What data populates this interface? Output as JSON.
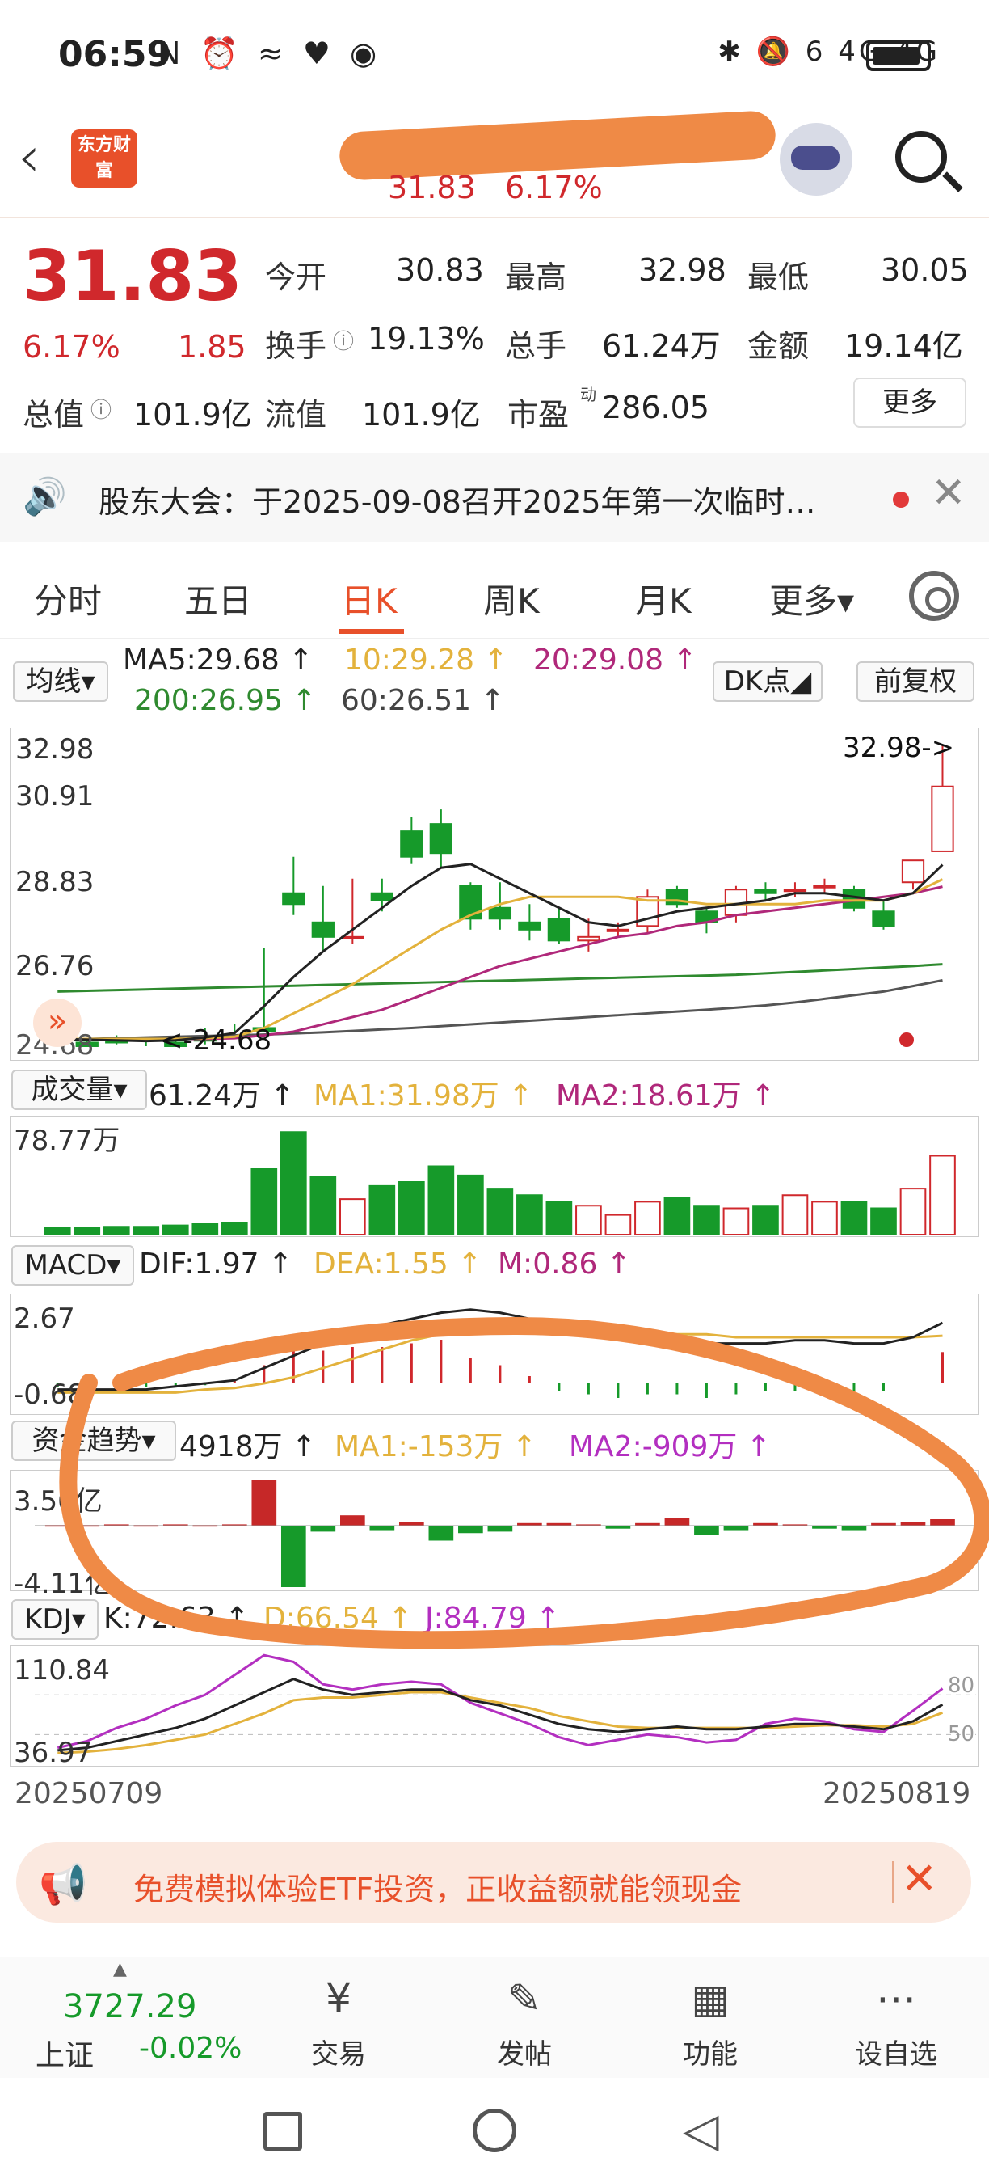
{
  "status_bar": {
    "time": "06:59",
    "left_icons": "N ⏰ ≈ ♥ ◉",
    "right_icons": "✱ 🔕 6 4G 4G"
  },
  "header": {
    "logo": "东方财富",
    "price": "31.83",
    "pct": "6.17%"
  },
  "quote": {
    "price": "31.83",
    "pct": "6.17%",
    "change": "1.85",
    "open_label": "今开",
    "open": "30.83",
    "high_label": "最高",
    "high": "32.98",
    "low_label": "最低",
    "low": "30.05",
    "turnover_label": "换手",
    "turnover": "19.13%",
    "volume_label": "总手",
    "volume": "61.24万",
    "amount_label": "金额",
    "amount": "19.14亿",
    "mktcap_label": "总值",
    "mktcap": "101.9亿",
    "float_label": "流值",
    "float": "101.9亿",
    "pe_label": "市盈",
    "pe_sup": "动",
    "pe": "286.05",
    "more": "更多"
  },
  "notice": {
    "text": "股东大会：于2025-09-08召开2025年第一次临时…"
  },
  "tabs": [
    "分时",
    "五日",
    "日K",
    "周K",
    "月K",
    "更多▾"
  ],
  "ma_bar": {
    "mode": "均线▾",
    "ma5": "MA5:29.68 ↑",
    "ma10": "10:29.28 ↑",
    "ma20": "20:29.08 ↑",
    "ma200": "200:26.95 ↑",
    "ma60": "60:26.51 ↑",
    "dk": "DK点◢",
    "fq": "前复权"
  },
  "kline": {
    "yticks": [
      "32.98",
      "30.91",
      "28.83",
      "26.76",
      "24.68"
    ],
    "high_marker": "32.98->",
    "low_marker": "<-24.68",
    "candles": [
      [
        24.9,
        25.0,
        24.8,
        24.7
      ],
      [
        24.8,
        24.9,
        24.7,
        24.7
      ],
      [
        24.9,
        25.0,
        24.8,
        24.75
      ],
      [
        24.9,
        24.95,
        24.85,
        24.7
      ],
      [
        24.8,
        25.0,
        24.7,
        24.68
      ],
      [
        24.9,
        25.2,
        24.85,
        24.75
      ],
      [
        25.0,
        25.3,
        24.95,
        24.9
      ],
      [
        25.2,
        27.4,
        25.1,
        25.1
      ],
      [
        28.9,
        29.9,
        28.6,
        28.3
      ],
      [
        28.1,
        29.1,
        27.7,
        27.3
      ],
      [
        27.7,
        29.3,
        27.7,
        27.5
      ],
      [
        28.9,
        29.3,
        28.7,
        28.4
      ],
      [
        30.6,
        31.0,
        29.9,
        29.7
      ],
      [
        30.8,
        31.2,
        30.0,
        29.6
      ],
      [
        29.1,
        29.2,
        28.2,
        27.9
      ],
      [
        28.5,
        29.2,
        28.2,
        27.9
      ],
      [
        28.1,
        28.6,
        27.9,
        27.6
      ],
      [
        28.2,
        28.5,
        27.6,
        27.5
      ],
      [
        27.6,
        28.2,
        27.7,
        27.3
      ],
      [
        27.9,
        28.1,
        27.9,
        27.7
      ],
      [
        28.0,
        29.0,
        28.8,
        27.8
      ],
      [
        29.0,
        29.1,
        28.6,
        28.5
      ],
      [
        28.4,
        28.5,
        28.1,
        27.8
      ],
      [
        28.3,
        29.1,
        29.0,
        28.1
      ],
      [
        29.0,
        29.2,
        28.9,
        28.7
      ],
      [
        29.0,
        29.2,
        29.0,
        28.8
      ],
      [
        29.1,
        29.3,
        29.1,
        28.9
      ],
      [
        29.0,
        29.1,
        28.5,
        28.4
      ],
      [
        28.4,
        28.7,
        28.0,
        27.9
      ],
      [
        29.2,
        29.8,
        29.8,
        29.0
      ],
      [
        30.05,
        32.98,
        31.83,
        30.05
      ]
    ],
    "ma5": [
      24.9,
      24.88,
      24.86,
      24.84,
      24.86,
      24.94,
      25.06,
      25.8,
      26.6,
      27.3,
      27.9,
      28.5,
      29.1,
      29.6,
      29.7,
      29.3,
      28.9,
      28.5,
      28.1,
      28.0,
      28.2,
      28.4,
      28.5,
      28.6,
      28.7,
      28.9,
      28.9,
      28.8,
      28.7,
      28.9,
      29.68
    ],
    "ma10": [
      24.9,
      24.9,
      24.9,
      24.9,
      24.9,
      24.92,
      24.96,
      25.2,
      25.6,
      26.0,
      26.4,
      26.9,
      27.4,
      27.9,
      28.3,
      28.6,
      28.8,
      28.8,
      28.8,
      28.8,
      28.7,
      28.7,
      28.6,
      28.6,
      28.6,
      28.6,
      28.7,
      28.7,
      28.7,
      28.9,
      29.28
    ],
    "ma20": [
      24.9,
      24.9,
      24.9,
      24.9,
      24.9,
      24.9,
      24.92,
      25.0,
      25.1,
      25.3,
      25.5,
      25.7,
      26.0,
      26.3,
      26.6,
      26.9,
      27.1,
      27.3,
      27.5,
      27.7,
      27.8,
      28.0,
      28.1,
      28.3,
      28.4,
      28.5,
      28.6,
      28.7,
      28.8,
      28.9,
      29.08
    ],
    "ma60": [
      24.9,
      24.9,
      24.92,
      24.94,
      24.96,
      24.98,
      25.0,
      25.02,
      25.05,
      25.08,
      25.12,
      25.16,
      25.2,
      25.25,
      25.3,
      25.35,
      25.4,
      25.45,
      25.5,
      25.55,
      25.6,
      25.65,
      25.7,
      25.76,
      25.82,
      25.9,
      26.0,
      26.1,
      26.2,
      26.35,
      26.51
    ],
    "ma200": [
      26.2,
      26.22,
      26.24,
      26.26,
      26.28,
      26.3,
      26.32,
      26.34,
      26.36,
      26.38,
      26.4,
      26.42,
      26.44,
      26.46,
      26.48,
      26.5,
      26.52,
      26.54,
      26.56,
      26.58,
      26.6,
      26.62,
      26.64,
      26.66,
      26.7,
      26.74,
      26.78,
      26.82,
      26.86,
      26.9,
      26.95
    ]
  },
  "volume": {
    "label": "成交量▾",
    "value": "61.24万 ↑",
    "ma1": "MA1:31.98万 ↑",
    "ma2": "MA2:18.61万 ↑",
    "ytick": "78.77万",
    "bars": [
      5,
      5,
      6,
      6,
      7,
      8,
      9,
      50,
      78,
      44,
      27,
      37,
      40,
      52,
      45,
      35,
      30,
      25,
      22,
      15,
      25,
      28,
      22,
      20,
      22,
      30,
      25,
      25,
      20,
      35,
      60
    ]
  },
  "macd": {
    "label": "MACD▾",
    "dif": "DIF:1.97 ↑",
    "dea": "DEA:1.55 ↑",
    "m": "M:0.86 ↑",
    "yticks": [
      "2.67",
      "-0.68"
    ]
  },
  "fund": {
    "label": "资金趋势▾",
    "value": "4918万 ↑",
    "ma1": "MA1:-153万 ↑",
    "ma2": "MA2:-909万 ↑",
    "yticks": [
      "3.50亿",
      "-4.11亿"
    ],
    "bars": [
      0.05,
      0.05,
      0.1,
      0.05,
      0.1,
      0.05,
      0.1,
      3.5,
      -4.11,
      -0.4,
      0.8,
      -0.3,
      0.3,
      -1.0,
      -0.5,
      -0.4,
      0.2,
      0.2,
      0.1,
      -0.2,
      0.2,
      0.6,
      -0.6,
      -0.3,
      0.2,
      0.1,
      -0.2,
      -0.3,
      0.2,
      0.3,
      0.5
    ]
  },
  "kdj": {
    "label": "KDJ▾",
    "k": "K:72.63 ↑",
    "d": "D:66.54 ↑",
    "j": "J:84.79 ↑",
    "yticks": [
      "110.84",
      "36.97"
    ],
    "right_ticks": [
      "80",
      "50"
    ],
    "dates": [
      "20250709",
      "20250819"
    ]
  },
  "ad": {
    "text": "免费模拟体验ETF投资，正收益额就能领现金"
  },
  "bottom_nav": {
    "index_value": "3727.29",
    "index_name": "上证",
    "index_pct": "-0.02%",
    "items": [
      "交易",
      "发帖",
      "功能",
      "设自选"
    ]
  },
  "colors": {
    "up": "#d0282c",
    "down": "#169a2a",
    "ma5": "#222222",
    "ma10": "#e3b23c",
    "ma20": "#b0287a",
    "ma60": "#555555",
    "ma200": "#2f8a2f",
    "accent": "#e8502a"
  }
}
